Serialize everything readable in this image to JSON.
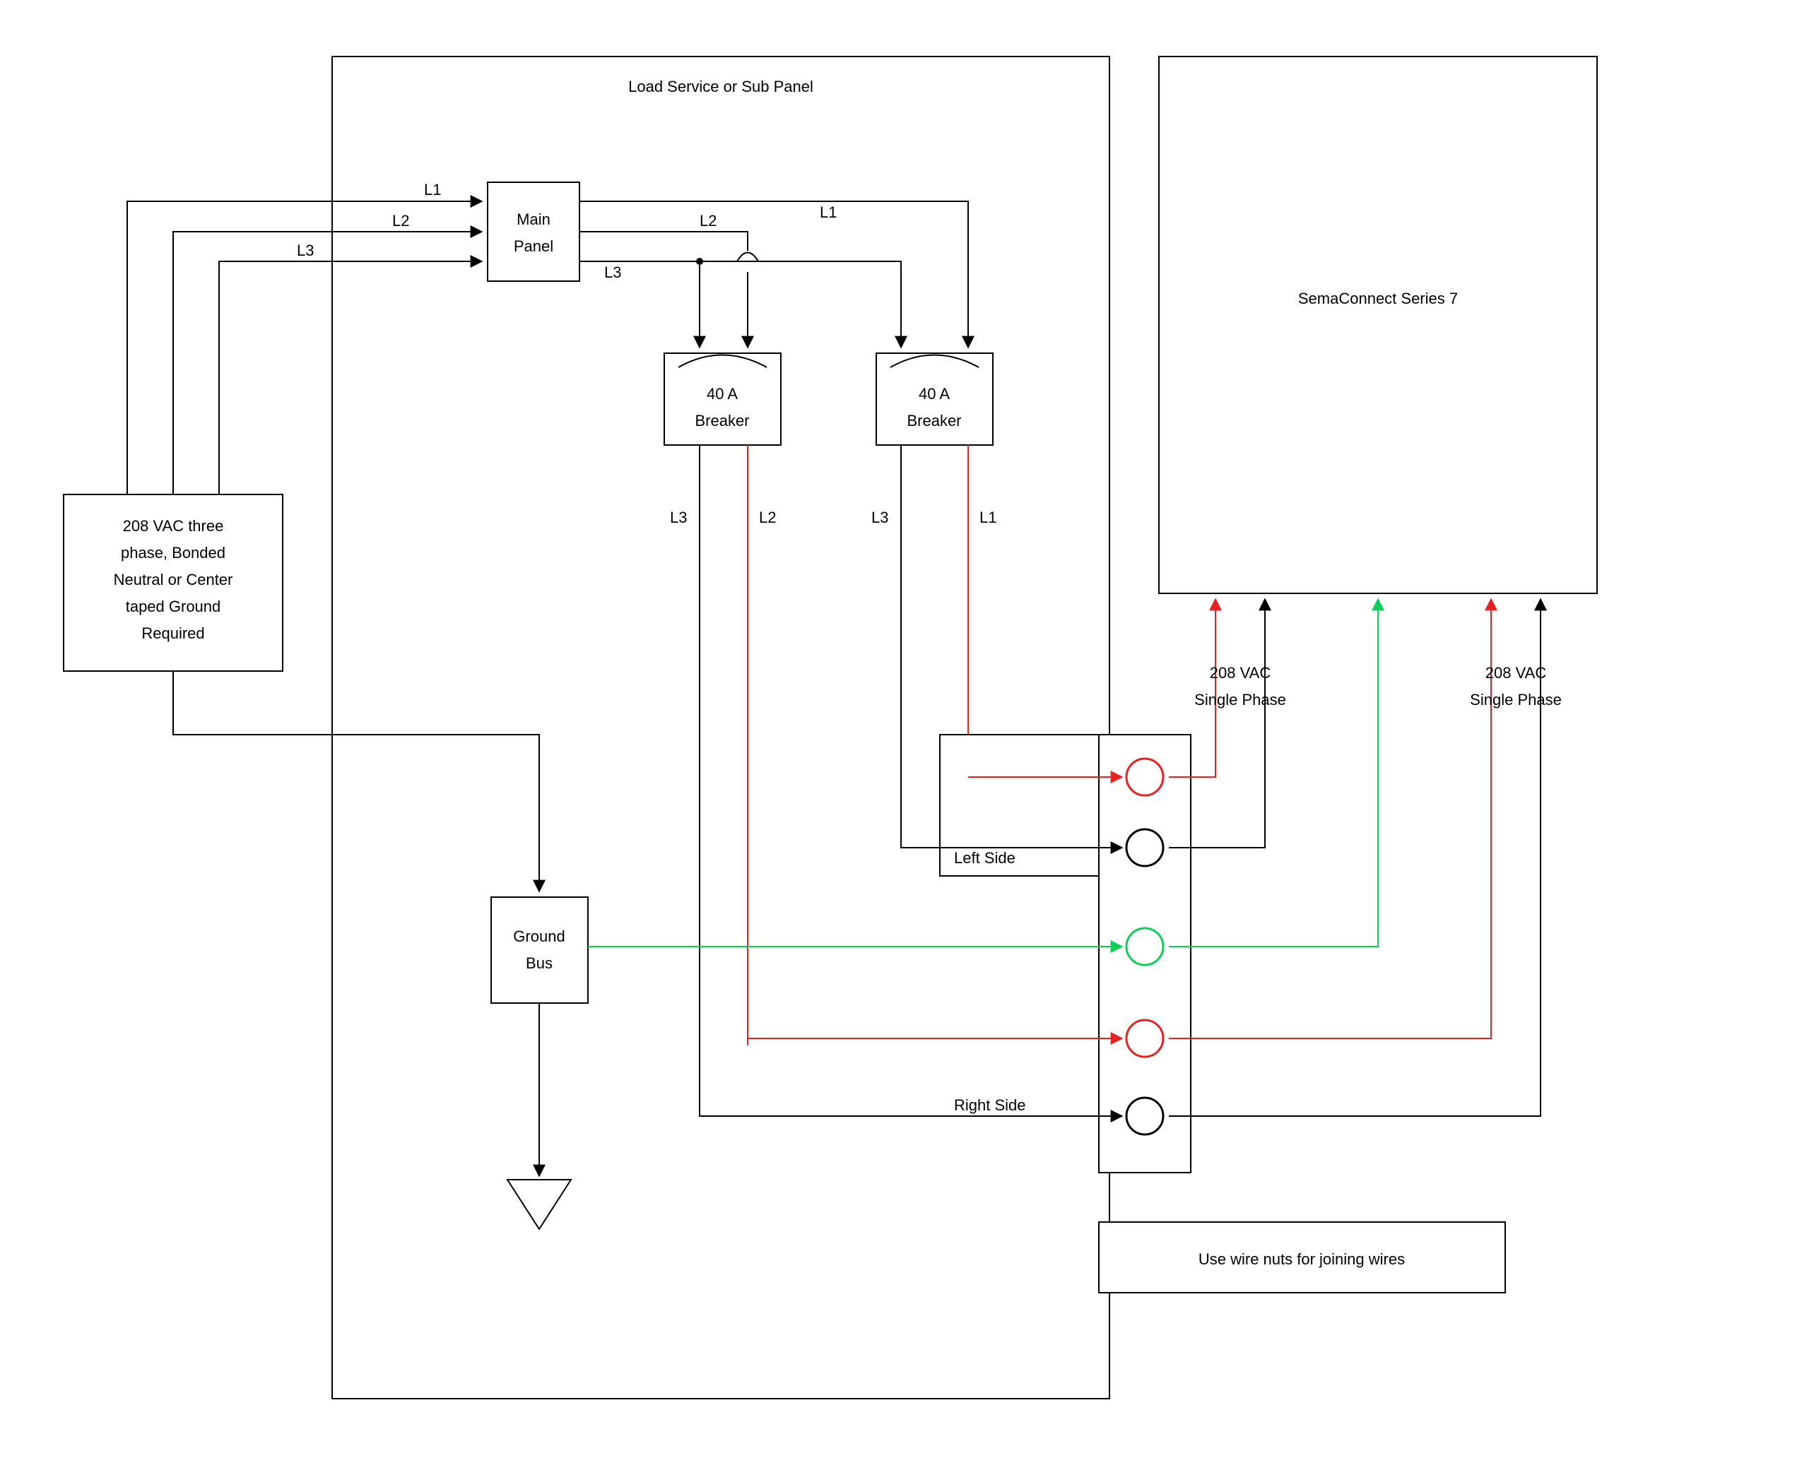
{
  "blocks": {
    "source": {
      "lines": [
        "208 VAC three",
        "phase, Bonded",
        "Neutral or Center",
        "taped Ground",
        "Required"
      ]
    },
    "outerPanel": {
      "title": "Load Service or Sub Panel"
    },
    "mainPanel": {
      "lines": [
        "Main",
        "Panel"
      ]
    },
    "breaker1": {
      "lines": [
        "40 A",
        "Breaker"
      ]
    },
    "breaker2": {
      "lines": [
        "40 A",
        "Breaker"
      ]
    },
    "groundBus": {
      "lines": [
        "Ground",
        "Bus"
      ]
    },
    "junction": {
      "labels": {
        "left": "Left Side",
        "right": "Right Side"
      }
    },
    "wireNuts": {
      "text": "Use wire nuts for joining wires"
    },
    "device": {
      "title": "SemaConnect Series 7"
    }
  },
  "labels": {
    "L1": "L1",
    "L2": "L2",
    "L3": "L3",
    "phase1": {
      "lines": [
        "208 VAC",
        "Single Phase"
      ]
    },
    "phase2": {
      "lines": [
        "208 VAC",
        "Single Phase"
      ]
    }
  },
  "colors": {
    "red": "#e52121",
    "green": "#0ccf58",
    "black": "#000000"
  }
}
